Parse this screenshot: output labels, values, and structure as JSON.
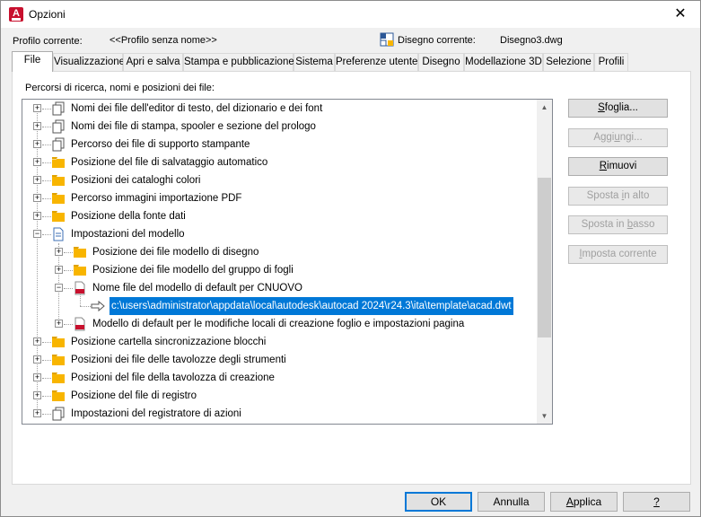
{
  "window": {
    "title": "Opzioni",
    "close_glyph": "✕"
  },
  "profile": {
    "label": "Profilo corrente:",
    "value": "<<Profilo senza nome>>"
  },
  "drawing": {
    "label": "Disegno corrente:",
    "value": "Disegno3.dwg"
  },
  "tabs": [
    "File",
    "Visualizzazione",
    "Apri e salva",
    "Stampa e pubblicazione",
    "Sistema",
    "Preferenze utente",
    "Disegno",
    "Modellazione 3D",
    "Selezione",
    "Profili"
  ],
  "tree_label": "Percorsi di ricerca, nomi e posizioni dei file:",
  "tree": [
    {
      "label": "Nomi dei file dell'editor di testo, del dizionario e dei font",
      "icon": "stacked-pages-icon"
    },
    {
      "label": "Nomi dei file di stampa, spooler e sezione del prologo",
      "icon": "stacked-pages-icon"
    },
    {
      "label": "Percorso dei file di supporto stampante",
      "icon": "stacked-pages-icon"
    },
    {
      "label": "Posizione del file di salvataggio automatico",
      "icon": "folder-icon"
    },
    {
      "label": "Posizioni dei cataloghi colori",
      "icon": "folder-icon"
    },
    {
      "label": "Percorso immagini importazione PDF",
      "icon": "folder-icon"
    },
    {
      "label": "Posizione della fonte dati",
      "icon": "folder-icon"
    },
    {
      "label": "Impostazioni del modello",
      "icon": "document-icon"
    },
    {
      "label": "Posizione dei file modello di disegno",
      "icon": "folder-icon"
    },
    {
      "label": "Posizione dei file modello del gruppo di fogli",
      "icon": "folder-icon"
    },
    {
      "label": "Nome file del modello di default per CNUOVO",
      "icon": "dwt-file-icon"
    },
    {
      "label": "c:\\users\\administrator\\appdata\\local\\autodesk\\autocad 2024\\r24.3\\ita\\template\\acad.dwt",
      "icon": "arrow-icon"
    },
    {
      "label": "Modello di default per le modifiche locali di creazione foglio e impostazioni pagina",
      "icon": "dwt-file-icon"
    },
    {
      "label": "Posizione cartella sincronizzazione blocchi",
      "icon": "folder-icon"
    },
    {
      "label": "Posizioni dei file delle tavolozze degli strumenti",
      "icon": "folder-icon"
    },
    {
      "label": "Posizioni del file della tavolozza di creazione",
      "icon": "folder-icon"
    },
    {
      "label": "Posizione del file di registro",
      "icon": "folder-icon"
    },
    {
      "label": "Impostazioni del registratore di azioni",
      "icon": "stacked-pages-icon"
    }
  ],
  "side_buttons": {
    "browse": {
      "pre": "",
      "key": "S",
      "post": "foglia..."
    },
    "add": {
      "pre": "Aggi",
      "key": "u",
      "post": "ngi..."
    },
    "remove": {
      "pre": "",
      "key": "R",
      "post": "imuovi"
    },
    "move_up": {
      "pre": "Sposta ",
      "key": "i",
      "post": "n alto"
    },
    "move_down": {
      "pre": "Sposta in ",
      "key": "b",
      "post": "asso"
    },
    "set_current": {
      "pre": "",
      "key": "I",
      "post": "mposta corrente"
    }
  },
  "footer": {
    "ok": "OK",
    "cancel": "Annulla",
    "apply_key": "A",
    "apply_rest": "pplica",
    "help": "?"
  },
  "colors": {
    "accent": "#0078d7",
    "folder": "#f8b500",
    "app": "#c8102e"
  }
}
